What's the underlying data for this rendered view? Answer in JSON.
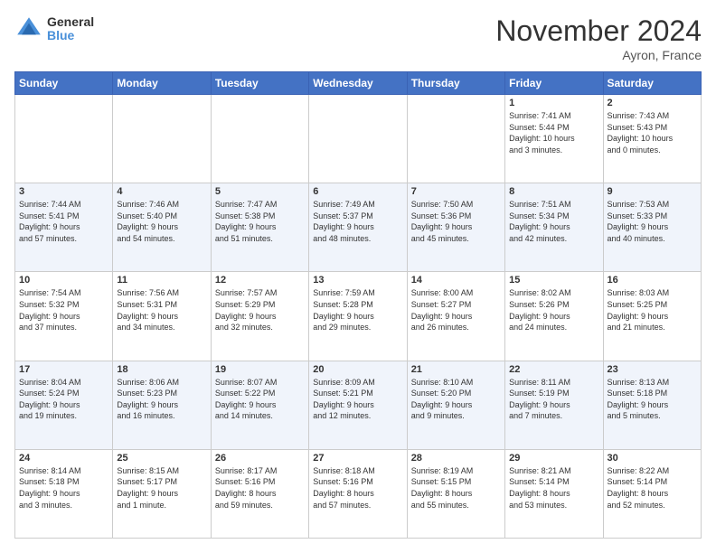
{
  "logo": {
    "general": "General",
    "blue": "Blue"
  },
  "title": "November 2024",
  "location": "Ayron, France",
  "days_of_week": [
    "Sunday",
    "Monday",
    "Tuesday",
    "Wednesday",
    "Thursday",
    "Friday",
    "Saturday"
  ],
  "weeks": [
    [
      {
        "day": "",
        "info": ""
      },
      {
        "day": "",
        "info": ""
      },
      {
        "day": "",
        "info": ""
      },
      {
        "day": "",
        "info": ""
      },
      {
        "day": "",
        "info": ""
      },
      {
        "day": "1",
        "info": "Sunrise: 7:41 AM\nSunset: 5:44 PM\nDaylight: 10 hours\nand 3 minutes."
      },
      {
        "day": "2",
        "info": "Sunrise: 7:43 AM\nSunset: 5:43 PM\nDaylight: 10 hours\nand 0 minutes."
      }
    ],
    [
      {
        "day": "3",
        "info": "Sunrise: 7:44 AM\nSunset: 5:41 PM\nDaylight: 9 hours\nand 57 minutes."
      },
      {
        "day": "4",
        "info": "Sunrise: 7:46 AM\nSunset: 5:40 PM\nDaylight: 9 hours\nand 54 minutes."
      },
      {
        "day": "5",
        "info": "Sunrise: 7:47 AM\nSunset: 5:38 PM\nDaylight: 9 hours\nand 51 minutes."
      },
      {
        "day": "6",
        "info": "Sunrise: 7:49 AM\nSunset: 5:37 PM\nDaylight: 9 hours\nand 48 minutes."
      },
      {
        "day": "7",
        "info": "Sunrise: 7:50 AM\nSunset: 5:36 PM\nDaylight: 9 hours\nand 45 minutes."
      },
      {
        "day": "8",
        "info": "Sunrise: 7:51 AM\nSunset: 5:34 PM\nDaylight: 9 hours\nand 42 minutes."
      },
      {
        "day": "9",
        "info": "Sunrise: 7:53 AM\nSunset: 5:33 PM\nDaylight: 9 hours\nand 40 minutes."
      }
    ],
    [
      {
        "day": "10",
        "info": "Sunrise: 7:54 AM\nSunset: 5:32 PM\nDaylight: 9 hours\nand 37 minutes."
      },
      {
        "day": "11",
        "info": "Sunrise: 7:56 AM\nSunset: 5:31 PM\nDaylight: 9 hours\nand 34 minutes."
      },
      {
        "day": "12",
        "info": "Sunrise: 7:57 AM\nSunset: 5:29 PM\nDaylight: 9 hours\nand 32 minutes."
      },
      {
        "day": "13",
        "info": "Sunrise: 7:59 AM\nSunset: 5:28 PM\nDaylight: 9 hours\nand 29 minutes."
      },
      {
        "day": "14",
        "info": "Sunrise: 8:00 AM\nSunset: 5:27 PM\nDaylight: 9 hours\nand 26 minutes."
      },
      {
        "day": "15",
        "info": "Sunrise: 8:02 AM\nSunset: 5:26 PM\nDaylight: 9 hours\nand 24 minutes."
      },
      {
        "day": "16",
        "info": "Sunrise: 8:03 AM\nSunset: 5:25 PM\nDaylight: 9 hours\nand 21 minutes."
      }
    ],
    [
      {
        "day": "17",
        "info": "Sunrise: 8:04 AM\nSunset: 5:24 PM\nDaylight: 9 hours\nand 19 minutes."
      },
      {
        "day": "18",
        "info": "Sunrise: 8:06 AM\nSunset: 5:23 PM\nDaylight: 9 hours\nand 16 minutes."
      },
      {
        "day": "19",
        "info": "Sunrise: 8:07 AM\nSunset: 5:22 PM\nDaylight: 9 hours\nand 14 minutes."
      },
      {
        "day": "20",
        "info": "Sunrise: 8:09 AM\nSunset: 5:21 PM\nDaylight: 9 hours\nand 12 minutes."
      },
      {
        "day": "21",
        "info": "Sunrise: 8:10 AM\nSunset: 5:20 PM\nDaylight: 9 hours\nand 9 minutes."
      },
      {
        "day": "22",
        "info": "Sunrise: 8:11 AM\nSunset: 5:19 PM\nDaylight: 9 hours\nand 7 minutes."
      },
      {
        "day": "23",
        "info": "Sunrise: 8:13 AM\nSunset: 5:18 PM\nDaylight: 9 hours\nand 5 minutes."
      }
    ],
    [
      {
        "day": "24",
        "info": "Sunrise: 8:14 AM\nSunset: 5:18 PM\nDaylight: 9 hours\nand 3 minutes."
      },
      {
        "day": "25",
        "info": "Sunrise: 8:15 AM\nSunset: 5:17 PM\nDaylight: 9 hours\nand 1 minute."
      },
      {
        "day": "26",
        "info": "Sunrise: 8:17 AM\nSunset: 5:16 PM\nDaylight: 8 hours\nand 59 minutes."
      },
      {
        "day": "27",
        "info": "Sunrise: 8:18 AM\nSunset: 5:16 PM\nDaylight: 8 hours\nand 57 minutes."
      },
      {
        "day": "28",
        "info": "Sunrise: 8:19 AM\nSunset: 5:15 PM\nDaylight: 8 hours\nand 55 minutes."
      },
      {
        "day": "29",
        "info": "Sunrise: 8:21 AM\nSunset: 5:14 PM\nDaylight: 8 hours\nand 53 minutes."
      },
      {
        "day": "30",
        "info": "Sunrise: 8:22 AM\nSunset: 5:14 PM\nDaylight: 8 hours\nand 52 minutes."
      }
    ]
  ]
}
